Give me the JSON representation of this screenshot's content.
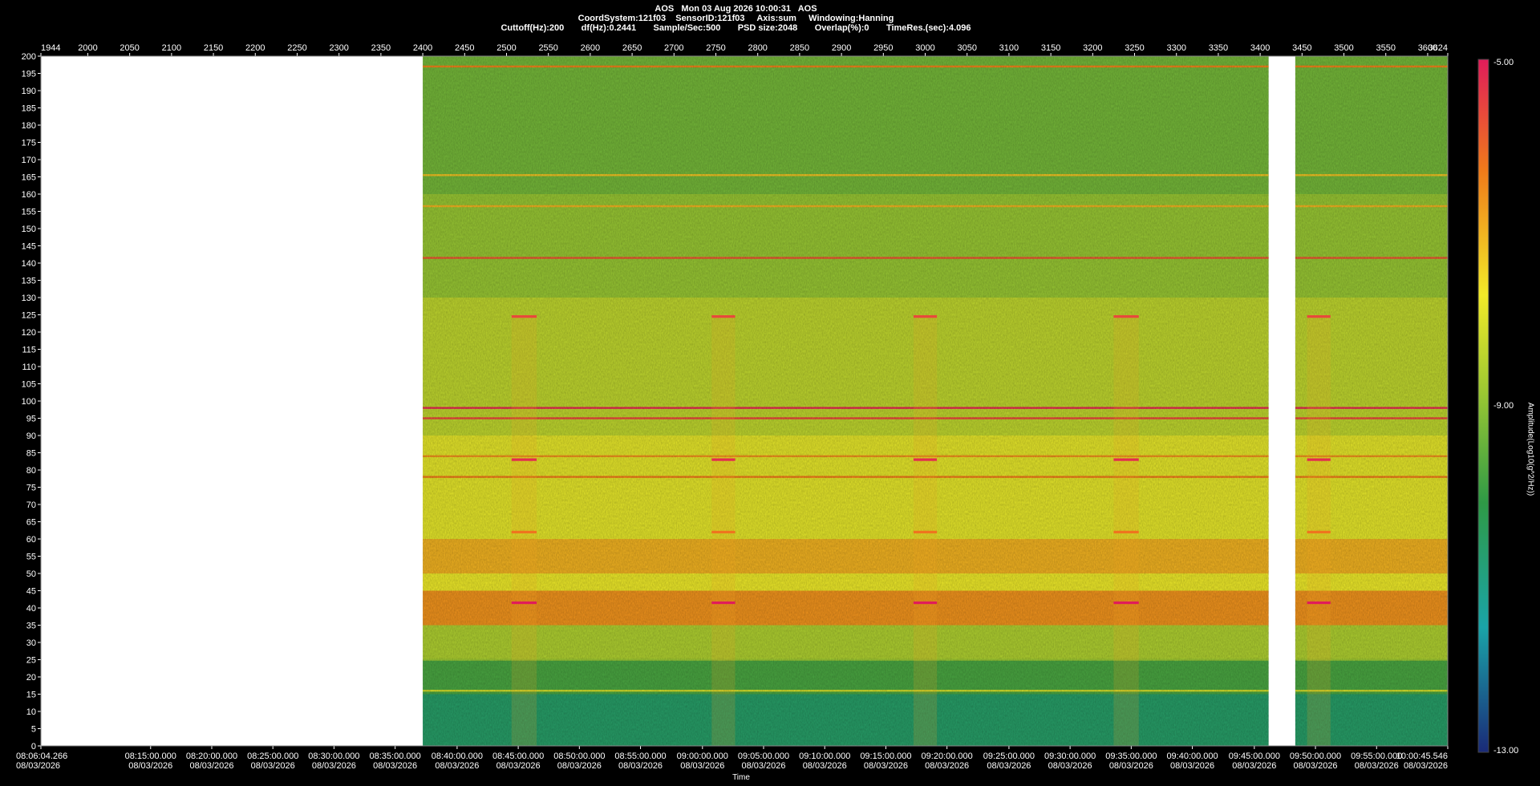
{
  "header": {
    "line1": "AOS   Mon 03 Aug 2026 10:00:31   AOS",
    "line2": "CoordSystem:121f03    SensorID:121f03     Axis:sum     Windowing:Hanning",
    "line3": "Cuttoff(Hz):200       df(Hz):0.2441       Sample/Sec:500       PSD size:2048       Overlap(%):0       TimeRes.(sec):4.096"
  },
  "colorbar": {
    "title": "Amplitude(Log10(g^2/Hz))",
    "max_label": "-5.00",
    "mid_label": "-9.00",
    "min_label": "-13.00",
    "range": [
      -13,
      -5
    ],
    "colors": [
      "#1a2a78",
      "#1aa4a8",
      "#2e9a46",
      "#9cc832",
      "#f2ea28",
      "#f07a1a",
      "#e01c5a"
    ]
  },
  "chart_data": {
    "type": "heatmap",
    "title": "",
    "ylabel": "",
    "xlabel": "Time",
    "ylim": [
      0,
      200
    ],
    "y_ticks": [
      0,
      5,
      10,
      15,
      20,
      25,
      30,
      35,
      40,
      45,
      50,
      55,
      60,
      65,
      70,
      75,
      80,
      85,
      90,
      95,
      100,
      105,
      110,
      115,
      120,
      125,
      130,
      135,
      140,
      145,
      150,
      155,
      160,
      165,
      170,
      175,
      180,
      185,
      190,
      195,
      200
    ],
    "top_axis": {
      "range": [
        1944,
        3624
      ],
      "ticks": [
        1944,
        2000,
        2050,
        2100,
        2150,
        2200,
        2250,
        2300,
        2350,
        2400,
        2450,
        2500,
        2550,
        2600,
        2650,
        2700,
        2750,
        2800,
        2850,
        2900,
        2950,
        3000,
        3050,
        3100,
        3150,
        3200,
        3250,
        3300,
        3350,
        3400,
        3450,
        3500,
        3550,
        3600,
        3624
      ]
    },
    "time_labels": [
      {
        "time": "08:06:04.266",
        "date": "08/03/2026",
        "frame": 1944
      },
      {
        "time": "08:15:00.000",
        "date": "08/03/2026",
        "frame": 2075
      },
      {
        "time": "08:20:00.000",
        "date": "08/03/2026",
        "frame": 2148
      },
      {
        "time": "08:25:00.000",
        "date": "08/03/2026",
        "frame": 2221
      },
      {
        "time": "08:30:00.000",
        "date": "08/03/2026",
        "frame": 2294
      },
      {
        "time": "08:35:00.000",
        "date": "08/03/2026",
        "frame": 2367
      },
      {
        "time": "08:40:00.000",
        "date": "08/03/2026",
        "frame": 2441
      },
      {
        "time": "08:45:00.000",
        "date": "08/03/2026",
        "frame": 2514
      },
      {
        "time": "08:50:00.000",
        "date": "08/03/2026",
        "frame": 2587
      },
      {
        "time": "08:55:00.000",
        "date": "08/03/2026",
        "frame": 2660
      },
      {
        "time": "09:00:00.000",
        "date": "08/03/2026",
        "frame": 2734
      },
      {
        "time": "09:05:00.000",
        "date": "08/03/2026",
        "frame": 2807
      },
      {
        "time": "09:10:00.000",
        "date": "08/03/2026",
        "frame": 2880
      },
      {
        "time": "09:15:00.000",
        "date": "08/03/2026",
        "frame": 2953
      },
      {
        "time": "09:20:00.000",
        "date": "08/03/2026",
        "frame": 3026
      },
      {
        "time": "09:25:00.000",
        "date": "08/03/2026",
        "frame": 3100
      },
      {
        "time": "09:30:00.000",
        "date": "08/03/2026",
        "frame": 3173
      },
      {
        "time": "09:35:00.000",
        "date": "08/03/2026",
        "frame": 3246
      },
      {
        "time": "09:40:00.000",
        "date": "08/03/2026",
        "frame": 3319
      },
      {
        "time": "09:45:00.000",
        "date": "08/03/2026",
        "frame": 3393
      },
      {
        "time": "09:50:00.000",
        "date": "08/03/2026",
        "frame": 3466
      },
      {
        "time": "09:55:00.000",
        "date": "08/03/2026",
        "frame": 3539
      },
      {
        "time": "10:00:45.546",
        "date": "08/03/2026",
        "frame": 3624
      }
    ],
    "data_ranges_frames": [
      [
        2400,
        3410
      ],
      [
        3442,
        3624
      ]
    ],
    "background_bands": [
      {
        "from_hz": 0,
        "to_hz": 15,
        "level": -10.6
      },
      {
        "from_hz": 15,
        "to_hz": 25,
        "level": -9.8
      },
      {
        "from_hz": 25,
        "to_hz": 35,
        "level": -8.6
      },
      {
        "from_hz": 35,
        "to_hz": 45,
        "level": -6.6
      },
      {
        "from_hz": 45,
        "to_hz": 50,
        "level": -7.8
      },
      {
        "from_hz": 50,
        "to_hz": 60,
        "level": -7.0
      },
      {
        "from_hz": 60,
        "to_hz": 90,
        "level": -7.9
      },
      {
        "from_hz": 90,
        "to_hz": 130,
        "level": -8.4
      },
      {
        "from_hz": 130,
        "to_hz": 160,
        "level": -8.9
      },
      {
        "from_hz": 160,
        "to_hz": 200,
        "level": -9.3
      }
    ],
    "tone_lines": [
      {
        "hz": 197,
        "level": -6.4
      },
      {
        "hz": 141.5,
        "level": -5.8
      },
      {
        "hz": 156.5,
        "level": -7.0
      },
      {
        "hz": 165.5,
        "level": -7.2
      },
      {
        "hz": 98,
        "level": -5.2
      },
      {
        "hz": 95,
        "level": -5.6
      },
      {
        "hz": 84,
        "level": -6.6
      },
      {
        "hz": 78,
        "level": -6.3
      },
      {
        "hz": 16,
        "level": -8.2
      },
      {
        "hz": 25,
        "level": -8.8
      }
    ],
    "periodic_bursts": [
      {
        "start_frame": 2506,
        "end_frame": 2536
      },
      {
        "start_frame": 2745,
        "end_frame": 2773
      },
      {
        "start_frame": 2986,
        "end_frame": 3014
      },
      {
        "start_frame": 3225,
        "end_frame": 3255
      },
      {
        "start_frame": 3456,
        "end_frame": 3484
      }
    ],
    "burst_tones": [
      {
        "hz": 124.5,
        "level": -5.6
      },
      {
        "hz": 83,
        "level": -5.2
      },
      {
        "hz": 62,
        "level": -6.2
      },
      {
        "hz": 41.5,
        "level": -5.0
      }
    ]
  }
}
